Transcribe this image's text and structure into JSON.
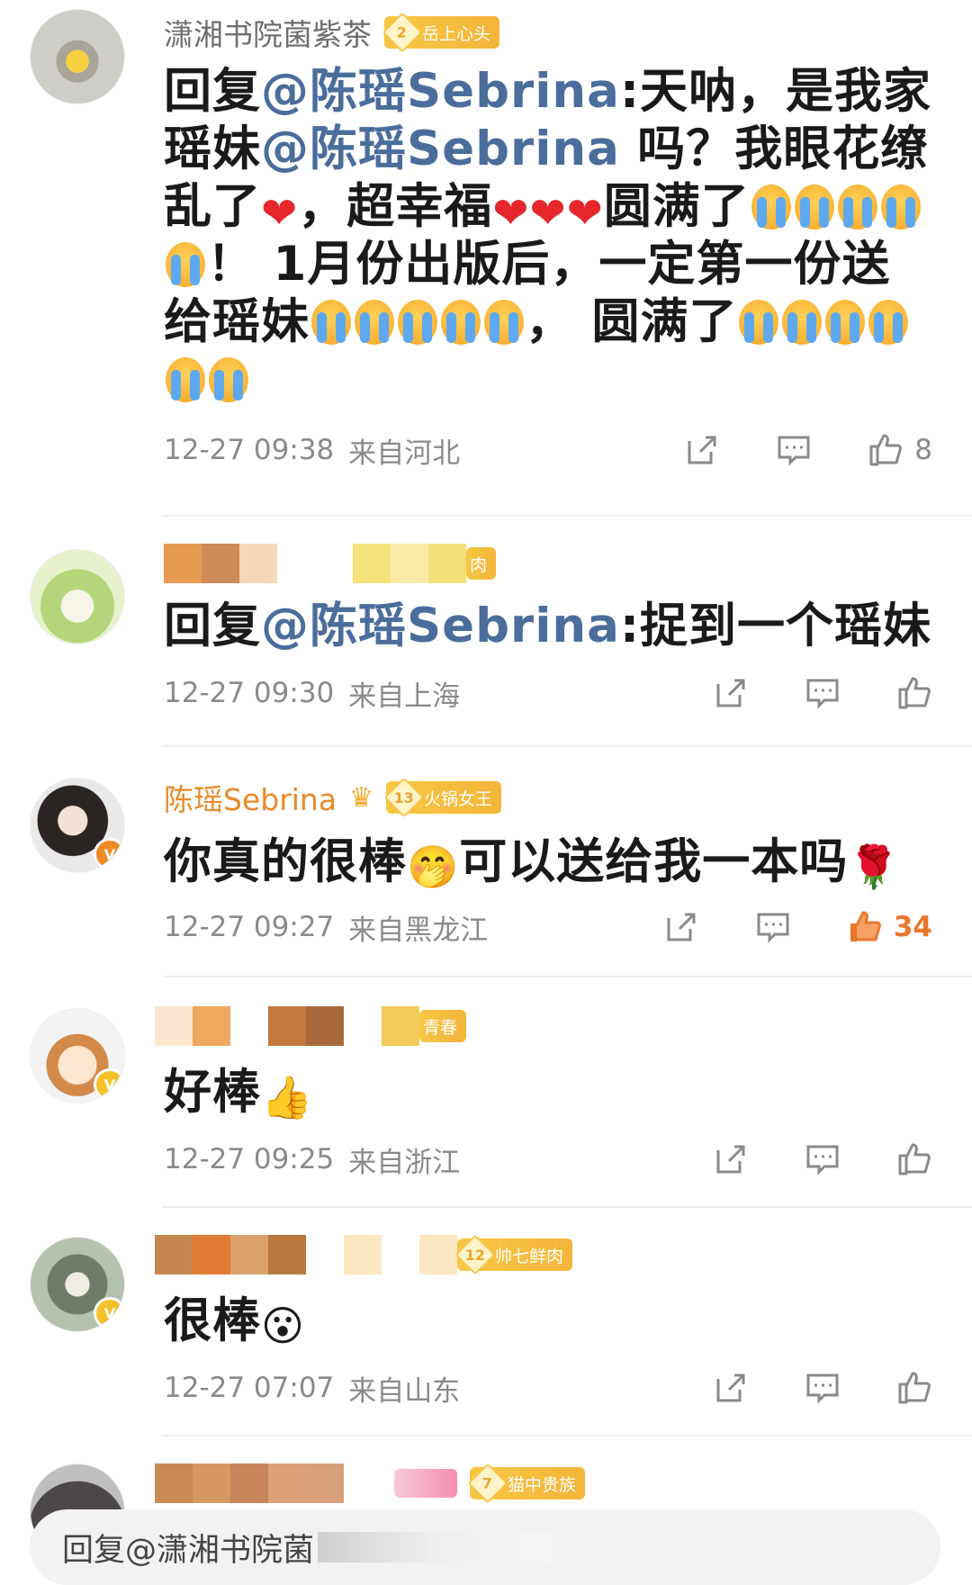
{
  "comments": [
    {
      "username": "潇湘书院菌紫茶",
      "badge_level": "2",
      "badge_text": "岳上心头",
      "segments": [
        {
          "t": "text",
          "v": "回复"
        },
        {
          "t": "mention",
          "v": "@陈瑶Sebrina"
        },
        {
          "t": "text",
          "v": ":天呐，是我家瑶妹"
        },
        {
          "t": "mention",
          "v": "@陈瑶Sebrina"
        },
        {
          "t": "text",
          "v": " 吗？我眼花缭乱了"
        },
        {
          "t": "heart"
        },
        {
          "t": "text",
          "v": "，超幸福"
        },
        {
          "t": "heart"
        },
        {
          "t": "heart"
        },
        {
          "t": "heart"
        },
        {
          "t": "text",
          "v": "圆满了"
        },
        {
          "t": "cry"
        },
        {
          "t": "cry"
        },
        {
          "t": "cry"
        },
        {
          "t": "cry"
        },
        {
          "t": "cry"
        },
        {
          "t": "text",
          "v": "！ 1月份出版后，一定第一份送给瑶妹"
        },
        {
          "t": "cry"
        },
        {
          "t": "cry"
        },
        {
          "t": "cry"
        },
        {
          "t": "cry"
        },
        {
          "t": "cry"
        },
        {
          "t": "text",
          "v": "， 圆满了"
        },
        {
          "t": "cry"
        },
        {
          "t": "cry"
        },
        {
          "t": "cry"
        },
        {
          "t": "cry"
        },
        {
          "t": "cry"
        },
        {
          "t": "cry"
        }
      ],
      "time": "12-27 09:38",
      "location": "来自河北",
      "likes": "8",
      "liked": false
    },
    {
      "username": "",
      "badge_text": "肉",
      "segments": [
        {
          "t": "text",
          "v": "回复"
        },
        {
          "t": "mention",
          "v": "@陈瑶Sebrina"
        },
        {
          "t": "text",
          "v": ":捉到一个瑶妹"
        }
      ],
      "time": "12-27 09:30",
      "location": "来自上海",
      "likes": "",
      "liked": false
    },
    {
      "username": "陈瑶Sebrina",
      "badge_level": "13",
      "badge_text": "火锅女王",
      "segments": [
        {
          "t": "text",
          "v": "你真的很棒"
        },
        {
          "t": "emoji",
          "v": "🤭"
        },
        {
          "t": "text",
          "v": "可以送给我一本吗"
        },
        {
          "t": "emoji",
          "v": "🌹"
        }
      ],
      "time": "12-27 09:27",
      "location": "来自黑龙江",
      "likes": "34",
      "liked": true
    },
    {
      "username": "",
      "badge_text": "青春",
      "segments": [
        {
          "t": "text",
          "v": "好棒"
        },
        {
          "t": "emoji",
          "v": "👍"
        }
      ],
      "time": "12-27 09:25",
      "location": "来自浙江",
      "likes": "",
      "liked": false
    },
    {
      "username": "",
      "badge_level": "12",
      "badge_text": "帅七鲜肉",
      "segments": [
        {
          "t": "text",
          "v": "很棒"
        },
        {
          "t": "emoji",
          "v": "😮"
        }
      ],
      "time": "12-27 07:07",
      "location": "来自山东",
      "likes": "",
      "liked": false
    }
  ],
  "partial_comment": {
    "badge_level": "7",
    "badge_text": "猫中贵族"
  },
  "reply_bar": {
    "placeholder": "回复@潇湘书院菌"
  },
  "colors": {
    "mention": "#4a6d9c",
    "liked": "#e8772d",
    "meta": "#8a8a8a",
    "badge": "#f4b53a"
  }
}
